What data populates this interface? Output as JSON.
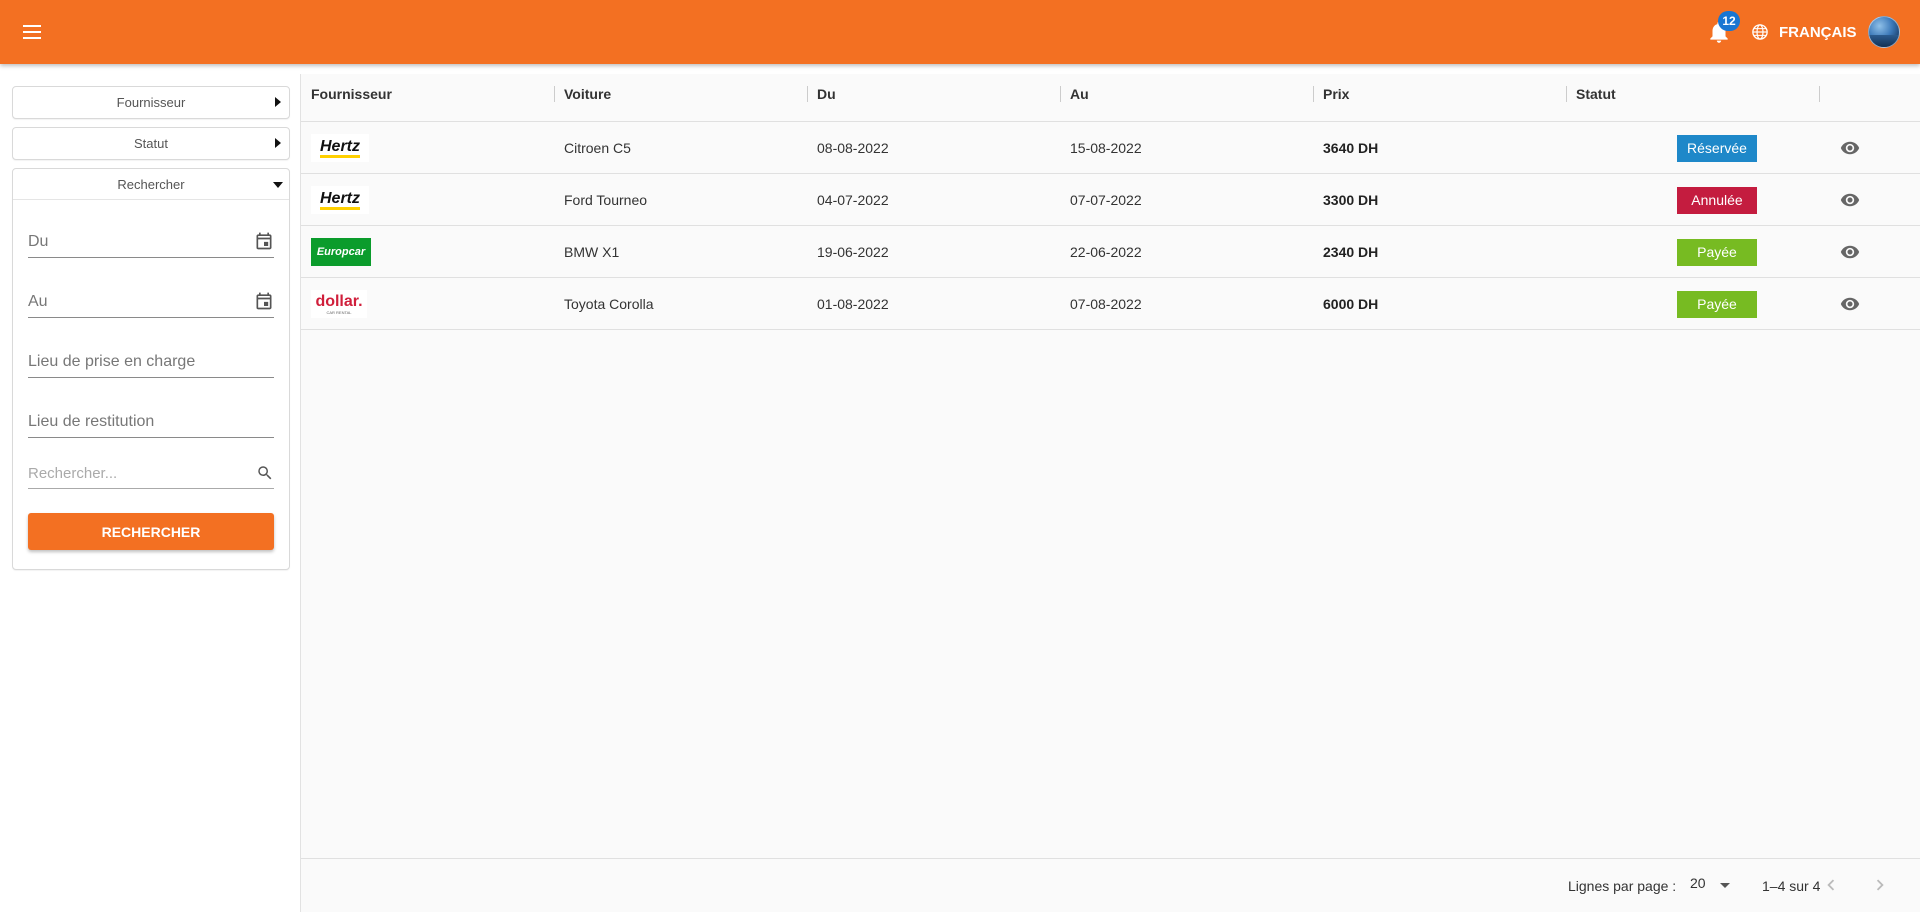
{
  "header": {
    "notification_count": "12",
    "language": "FRANÇAIS"
  },
  "sidebar": {
    "accordions": [
      {
        "label": "Fournisseur"
      },
      {
        "label": "Statut"
      },
      {
        "label": "Rechercher"
      }
    ],
    "fields": {
      "from": "Du",
      "to": "Au",
      "pickup": "Lieu de prise en charge",
      "dropoff": "Lieu de restitution",
      "search_placeholder": "Rechercher..."
    },
    "search_button": "RECHERCHER"
  },
  "table": {
    "columns": [
      "Fournisseur",
      "Voiture",
      "Du",
      "Au",
      "Prix",
      "Statut"
    ],
    "rows": [
      {
        "supplier": "Hertz",
        "car": "Citroen C5",
        "from": "08-08-2022",
        "to": "15-08-2022",
        "price": "3640 DH",
        "status": "Réservée",
        "status_color": "#1e88c9"
      },
      {
        "supplier": "Hertz",
        "car": "Ford Tourneo",
        "from": "04-07-2022",
        "to": "07-07-2022",
        "price": "3300 DH",
        "status": "Annulée",
        "status_color": "#c41c3f"
      },
      {
        "supplier": "Europcar",
        "car": "BMW X1",
        "from": "19-06-2022",
        "to": "22-06-2022",
        "price": "2340 DH",
        "status": "Payée",
        "status_color": "#77bb22"
      },
      {
        "supplier": "dollar.",
        "supplier_sub": "CAR RENTAL",
        "car": "Toyota Corolla",
        "from": "01-08-2022",
        "to": "07-08-2022",
        "price": "6000 DH",
        "status": "Payée",
        "status_color": "#77bb22"
      }
    ]
  },
  "pagination": {
    "rows_label": "Lignes par page :",
    "rows_per_page": "20",
    "range": "1–4 sur 4"
  },
  "colors": {
    "brand": "#f37022",
    "badge": "#1976d2"
  }
}
